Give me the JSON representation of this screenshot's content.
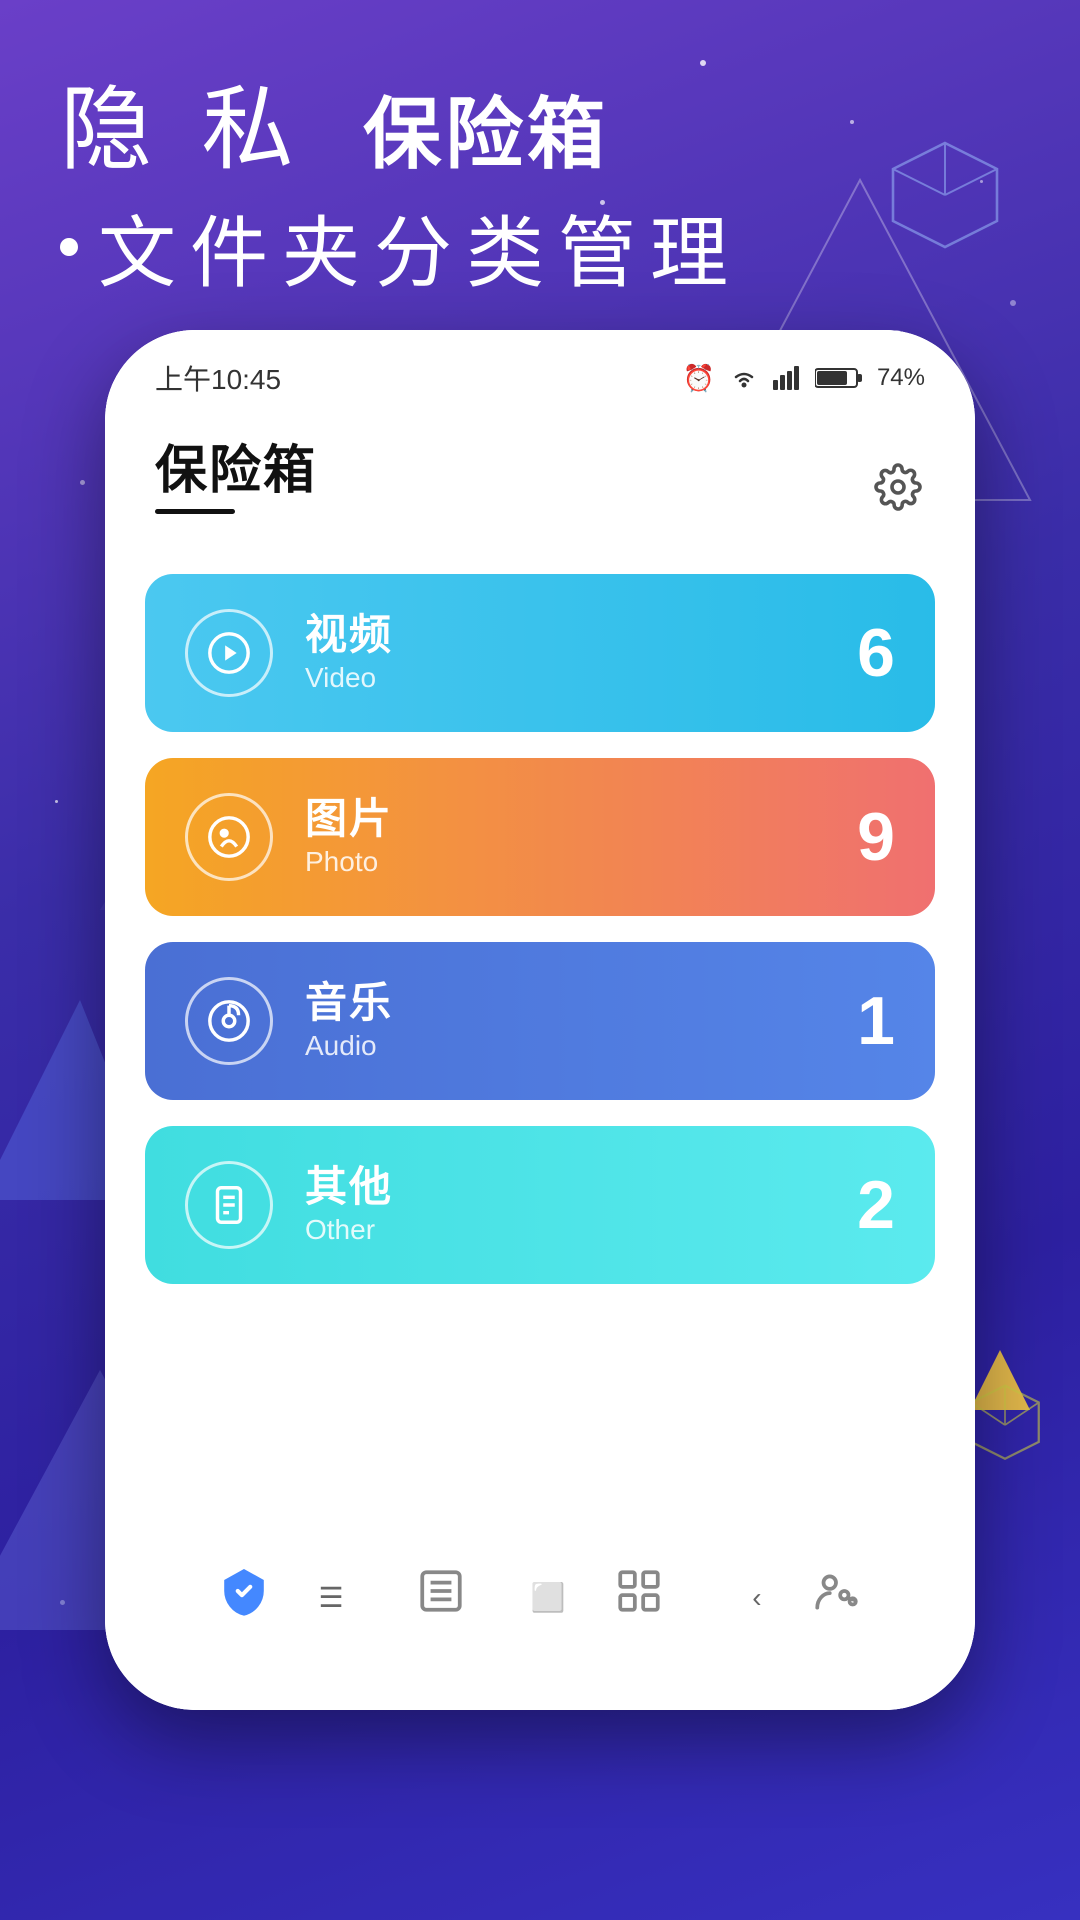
{
  "background": {
    "gradient_start": "#6a3fc8",
    "gradient_end": "#3a2da8"
  },
  "header": {
    "line1_part1": "隐 私",
    "line1_part2": "保险箱",
    "line2": "文件夹分类管理"
  },
  "phone": {
    "status_bar": {
      "time": "上午10:45",
      "battery": "74%"
    },
    "app_title": "保险箱",
    "settings_label": "设置",
    "categories": [
      {
        "id": "video",
        "name_zh": "视频",
        "name_en": "Video",
        "count": "6",
        "color_class": "video"
      },
      {
        "id": "photo",
        "name_zh": "图片",
        "name_en": "Photo",
        "count": "9",
        "color_class": "photo"
      },
      {
        "id": "audio",
        "name_zh": "音乐",
        "name_en": "Audio",
        "count": "1",
        "color_class": "audio"
      },
      {
        "id": "other",
        "name_zh": "其他",
        "name_en": "Other",
        "count": "2",
        "color_class": "other"
      }
    ],
    "bottom_nav": [
      {
        "id": "vault",
        "icon": "shield",
        "active": true
      },
      {
        "id": "list",
        "icon": "list",
        "active": false
      },
      {
        "id": "apps",
        "icon": "grid",
        "active": false
      },
      {
        "id": "user",
        "icon": "user",
        "active": false
      }
    ]
  }
}
